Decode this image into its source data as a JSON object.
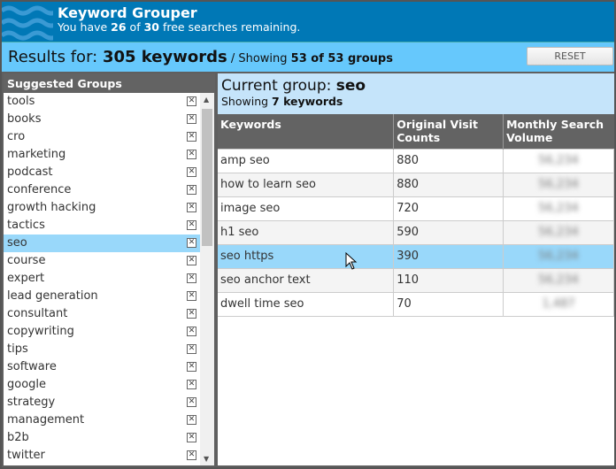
{
  "header": {
    "title": "Keyword Grouper",
    "sub_pre": "You have ",
    "used": "26",
    "sub_mid": " of ",
    "total": "30",
    "sub_post": " free searches remaining."
  },
  "results": {
    "label": "Results for: ",
    "count": "305 keywords",
    "sep": " / Showing ",
    "groups": "53 of 53 groups",
    "reset": "RESET"
  },
  "sidebar": {
    "title": "Suggested Groups",
    "items": [
      "tools",
      "books",
      "cro",
      "marketing",
      "podcast",
      "conference",
      "growth hacking",
      "tactics",
      "seo",
      "course",
      "expert",
      "lead generation",
      "consultant",
      "copywriting",
      "tips",
      "software",
      "google",
      "strategy",
      "management",
      "b2b",
      "twitter"
    ],
    "selected": "seo"
  },
  "current": {
    "label": "Current group: ",
    "name": "seo",
    "showing_pre": "Showing ",
    "showing": "7 keywords"
  },
  "table": {
    "headers": [
      "Keywords",
      "Original Visit Counts",
      "Monthly Search Volume"
    ],
    "rows": [
      [
        "amp seo",
        "880",
        "56,234"
      ],
      [
        "how to learn seo",
        "880",
        "56,234"
      ],
      [
        "image seo",
        "720",
        "56,234"
      ],
      [
        "h1 seo",
        "590",
        "56,234"
      ],
      [
        "seo https",
        "390",
        "56,234"
      ],
      [
        "seo anchor text",
        "110",
        "56,234"
      ],
      [
        "dwell time seo",
        "70",
        "1,487"
      ]
    ]
  }
}
